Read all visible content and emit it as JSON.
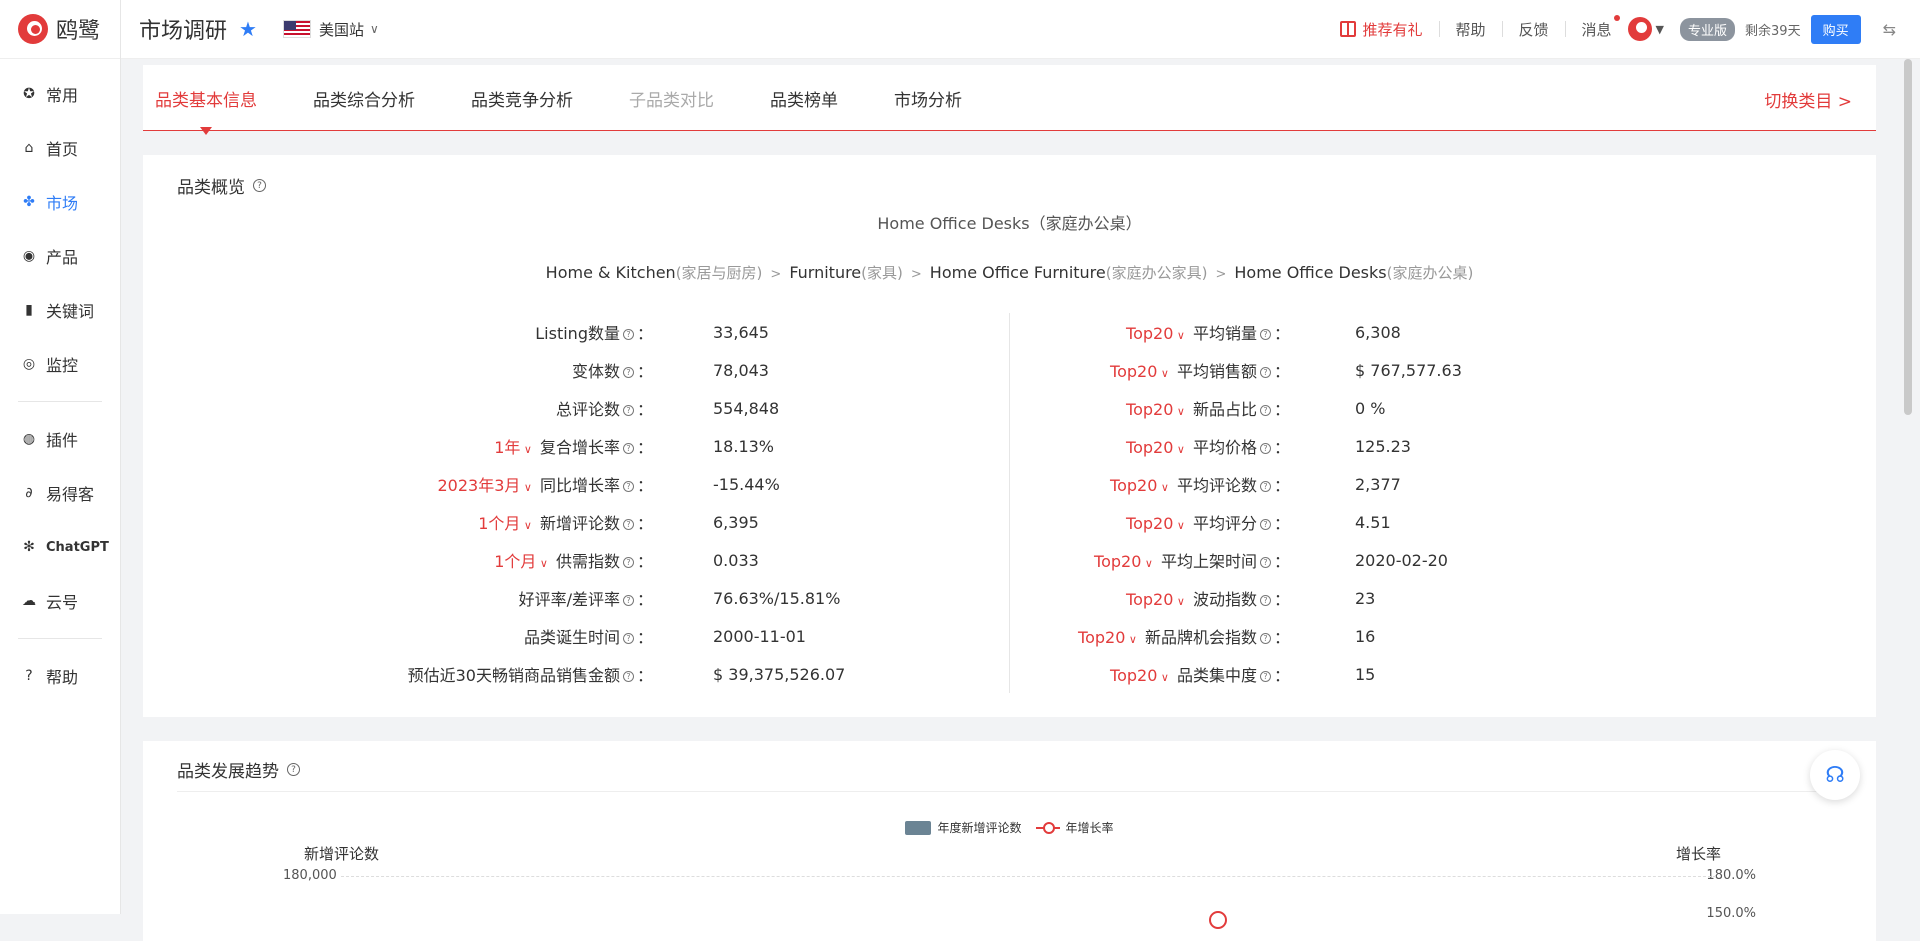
{
  "app": {
    "logo_text": "鸥鹭",
    "title": "市场调研",
    "site": "美国站"
  },
  "nav": [
    {
      "label": "常用",
      "icon": "bookmark-icon",
      "active": false
    },
    {
      "label": "首页",
      "icon": "home-icon",
      "active": false
    },
    {
      "label": "市场",
      "icon": "market-icon",
      "active": true
    },
    {
      "label": "产品",
      "icon": "eye-icon",
      "active": false
    },
    {
      "label": "关键词",
      "icon": "bar-chart-icon",
      "active": false
    },
    {
      "label": "监控",
      "icon": "monitor-icon",
      "active": false
    },
    {
      "label": "插件",
      "icon": "chrome-icon",
      "active": false
    },
    {
      "label": "易得客",
      "icon": "edk-icon",
      "active": false
    },
    {
      "label": "ChatGPT",
      "icon": "chatgpt-icon",
      "active": false
    },
    {
      "label": "云号",
      "icon": "cloud-icon",
      "active": false
    },
    {
      "label": "帮助",
      "icon": "help-icon",
      "active": false
    }
  ],
  "topbar": {
    "recommend": "推荐有礼",
    "help": "帮助",
    "feedback": "反馈",
    "messages": "消息",
    "plan": "专业版",
    "remaining": "剩余39天",
    "buy": "购买"
  },
  "tabs": [
    {
      "label": "品类基本信息",
      "state": "active"
    },
    {
      "label": "品类综合分析",
      "state": "normal"
    },
    {
      "label": "品类竞争分析",
      "state": "normal"
    },
    {
      "label": "子品类对比",
      "state": "disabled"
    },
    {
      "label": "品类榜单",
      "state": "normal"
    },
    {
      "label": "市场分析",
      "state": "normal"
    }
  ],
  "switch_category": "切换类目 >",
  "overview": {
    "title": "品类概览",
    "category_name": "Home Office Desks（家庭办公桌）",
    "breadcrumb": [
      {
        "en": "Home & Kitchen",
        "cn": "(家居与厨房)"
      },
      {
        "en": "Furniture",
        "cn": "(家具)"
      },
      {
        "en": "Home Office Furniture",
        "cn": "(家庭办公家具)"
      },
      {
        "en": "Home Office Desks",
        "cn": "(家庭办公桌)"
      }
    ],
    "left_stats": [
      {
        "selector": "",
        "label": "Listing数量",
        "value": "33,645"
      },
      {
        "selector": "",
        "label": "变体数",
        "value": "78,043"
      },
      {
        "selector": "",
        "label": "总评论数",
        "value": "554,848"
      },
      {
        "selector": "1年",
        "label": "复合增长率",
        "value": "18.13%"
      },
      {
        "selector": "2023年3月",
        "label": "同比增长率",
        "value": "-15.44%"
      },
      {
        "selector": "1个月",
        "label": "新增评论数",
        "value": "6,395"
      },
      {
        "selector": "1个月",
        "label": "供需指数",
        "value": "0.033"
      },
      {
        "selector": "",
        "label": "好评率/差评率",
        "value": "76.63%/15.81%"
      },
      {
        "selector": "",
        "label": "品类诞生时间",
        "value": "2000-11-01"
      },
      {
        "selector": "",
        "label": "预估近30天畅销商品销售金额",
        "value": "$ 39,375,526.07"
      }
    ],
    "right_stats": [
      {
        "selector": "Top20",
        "label": "平均销量",
        "value": "6,308"
      },
      {
        "selector": "Top20",
        "label": "平均销售额",
        "value": "$ 767,577.63"
      },
      {
        "selector": "Top20",
        "label": "新品占比",
        "value": "0 %"
      },
      {
        "selector": "Top20",
        "label": "平均价格",
        "value": "125.23"
      },
      {
        "selector": "Top20",
        "label": "平均评论数",
        "value": "2,377"
      },
      {
        "selector": "Top20",
        "label": "平均评分",
        "value": "4.51"
      },
      {
        "selector": "Top20",
        "label": "平均上架时间",
        "value": "2020-02-20"
      },
      {
        "selector": "Top20",
        "label": "波动指数",
        "value": "23"
      },
      {
        "selector": "Top20",
        "label": "新品牌机会指数",
        "value": "16"
      },
      {
        "selector": "Top20",
        "label": "品类集中度",
        "value": "15"
      }
    ]
  },
  "trend": {
    "title": "品类发展趋势",
    "legend_bar": "年度新增评论数",
    "legend_line": "年增长率",
    "y_left_label": "新增评论数",
    "y_right_label": "增长率",
    "y_left_top": "180,000",
    "y_right_top": "180.0%",
    "y_right_second": "150.0%"
  },
  "colors": {
    "accent": "#e23b3b",
    "brand_blue": "#2f7df6",
    "bar": "#6b8494"
  }
}
